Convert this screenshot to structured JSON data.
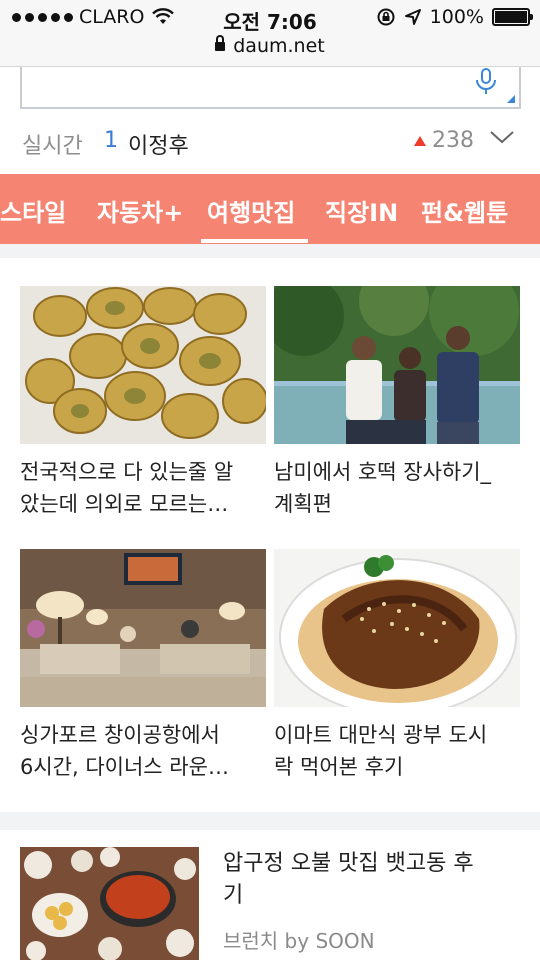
{
  "status": {
    "carrier": "CLARO",
    "time": "오전 7:06",
    "battery": "100%"
  },
  "browser": {
    "url": "daum.net"
  },
  "realtime": {
    "label": "실시간",
    "rank": "1",
    "keyword": "이정후",
    "count": "238"
  },
  "tabs": [
    {
      "label": "스타일"
    },
    {
      "label": "자동차+"
    },
    {
      "label": "여행맛집",
      "selected": true
    },
    {
      "label": "직장IN"
    },
    {
      "label": "펀&웹툰"
    }
  ],
  "cards": [
    {
      "title_line1": "전국적으로 다 있는줄 알",
      "title_line2": "았는데 의외로 모르는…"
    },
    {
      "title_line1": "남미에서 호떡 장사하기_",
      "title_line2": "계획편"
    },
    {
      "title_line1": "싱가포르 창이공항에서",
      "title_line2": "6시간, 다이너스 라운…"
    },
    {
      "title_line1": "이마트 대만식 광부 도시",
      "title_line2": "락 먹어본 후기"
    }
  ],
  "list_item": {
    "title_line1": "압구정 오불 맛집 뱃고동 후",
    "title_line2": "기",
    "source": "브런치 by SOON"
  },
  "colors": {
    "tab_bar": "#f58473",
    "rank_blue": "#3a7ad9",
    "up_arrow": "#ef3b2c"
  }
}
